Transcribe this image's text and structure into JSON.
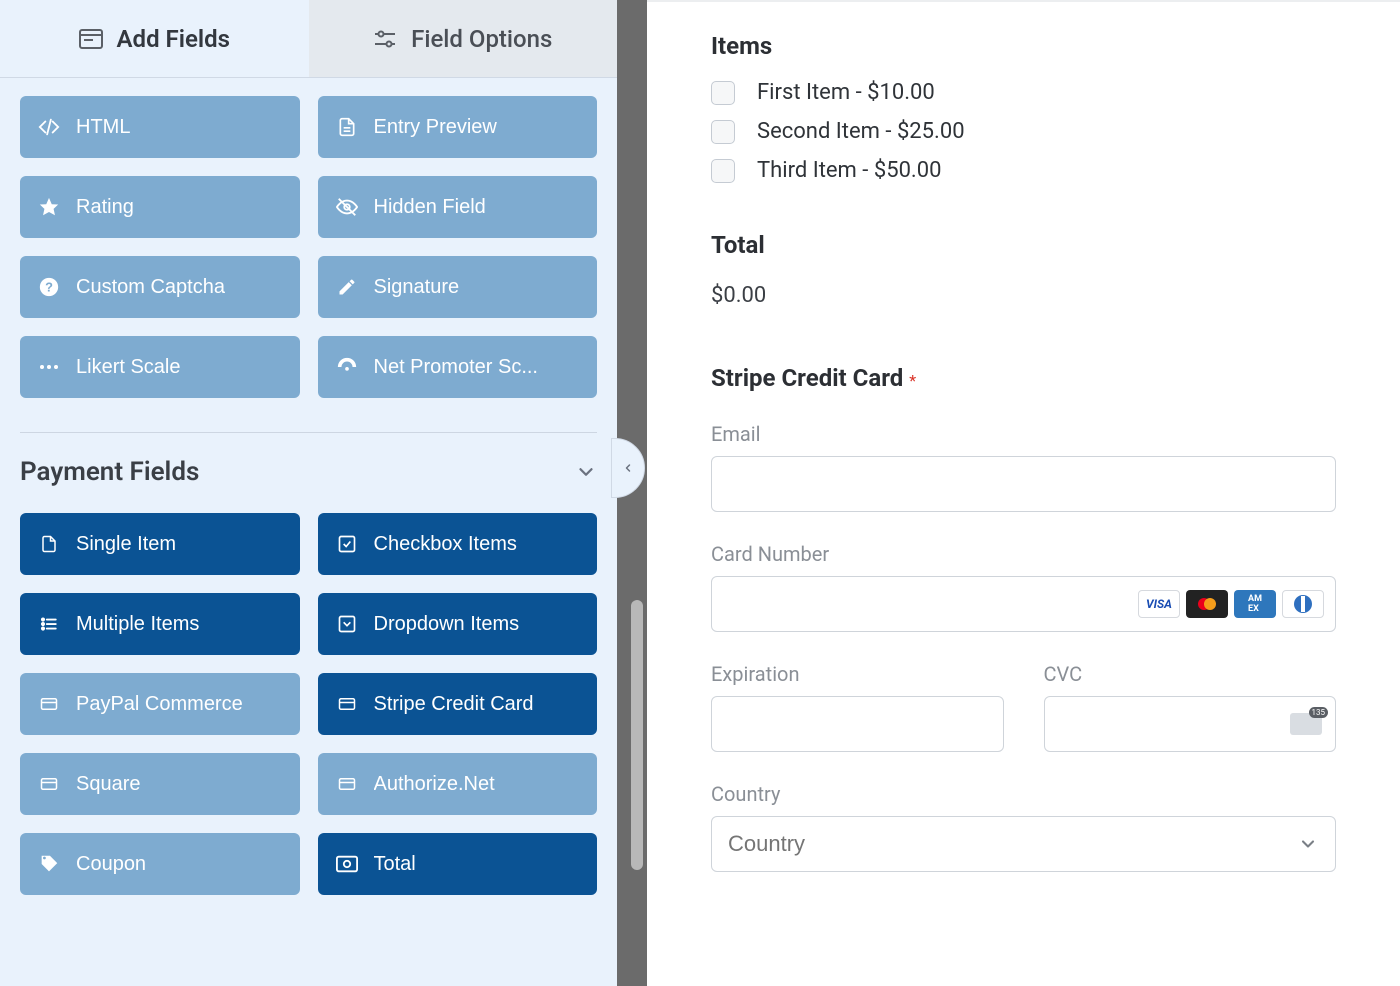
{
  "tabs": {
    "add_fields": "Add Fields",
    "field_options": "Field Options"
  },
  "fancy_fields": [
    {
      "icon": "code-icon",
      "label": "HTML",
      "tone": "light"
    },
    {
      "icon": "document-icon",
      "label": "Entry Preview",
      "tone": "light"
    },
    {
      "icon": "star-icon",
      "label": "Rating",
      "tone": "light"
    },
    {
      "icon": "eye-off-icon",
      "label": "Hidden Field",
      "tone": "light"
    },
    {
      "icon": "question-icon",
      "label": "Custom Captcha",
      "tone": "light"
    },
    {
      "icon": "pencil-icon",
      "label": "Signature",
      "tone": "light"
    },
    {
      "icon": "dots-icon",
      "label": "Likert Scale",
      "tone": "light"
    },
    {
      "icon": "gauge-icon",
      "label": "Net Promoter Sc...",
      "tone": "light"
    }
  ],
  "payment_section_title": "Payment Fields",
  "payment_fields": [
    {
      "icon": "file-icon",
      "label": "Single Item",
      "tone": "dark"
    },
    {
      "icon": "check-square-icon",
      "label": "Checkbox Items",
      "tone": "dark"
    },
    {
      "icon": "list-icon",
      "label": "Multiple Items",
      "tone": "dark"
    },
    {
      "icon": "caret-square-icon",
      "label": "Dropdown Items",
      "tone": "dark"
    },
    {
      "icon": "card-icon",
      "label": "PayPal Commerce",
      "tone": "light"
    },
    {
      "icon": "card-icon",
      "label": "Stripe Credit Card",
      "tone": "dark"
    },
    {
      "icon": "card-icon",
      "label": "Square",
      "tone": "light"
    },
    {
      "icon": "card-icon",
      "label": "Authorize.Net",
      "tone": "light"
    },
    {
      "icon": "tag-icon",
      "label": "Coupon",
      "tone": "light"
    },
    {
      "icon": "money-icon",
      "label": "Total",
      "tone": "dark"
    }
  ],
  "preview": {
    "items_label": "Items",
    "items": [
      "First Item - $10.00",
      "Second Item - $25.00",
      "Third Item - $50.00"
    ],
    "total_label": "Total",
    "total_value": "$0.00",
    "stripe_label": "Stripe Credit Card",
    "email_label": "Email",
    "card_number_label": "Card Number",
    "expiration_label": "Expiration",
    "cvc_label": "CVC",
    "country_label": "Country",
    "country_placeholder": "Country",
    "card_brands": [
      "VISA",
      "mc",
      "AMEX",
      "diners"
    ]
  }
}
